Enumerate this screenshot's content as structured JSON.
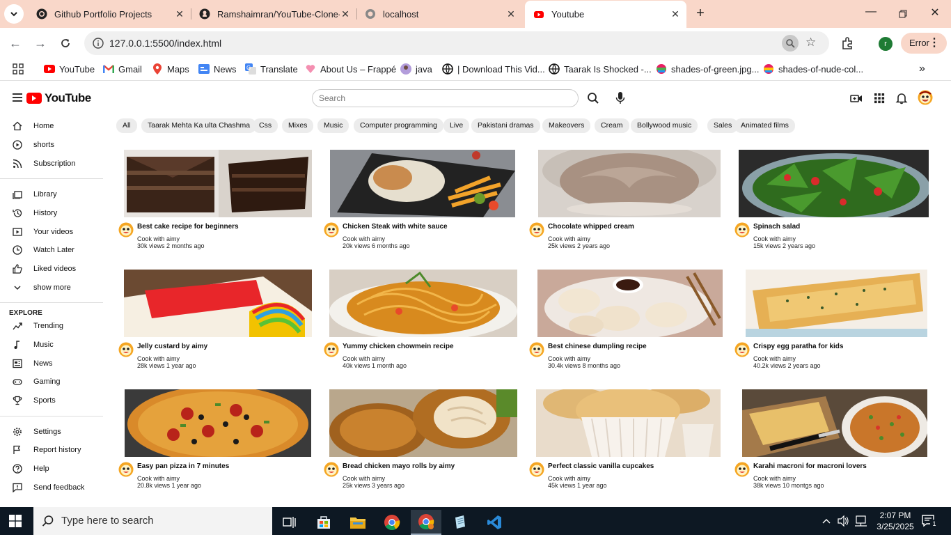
{
  "browser": {
    "tabs": [
      {
        "title": "Github Portfolio Projects",
        "icon": "github-circle-icon"
      },
      {
        "title": "Ramshaimran/YouTube-Clone-i",
        "icon": "github-icon"
      },
      {
        "title": "localhost",
        "icon": "globe-icon"
      },
      {
        "title": "Youtube",
        "icon": "youtube-icon",
        "active": true
      }
    ],
    "url": "127.0.0.1:5500/index.html",
    "profile_initial": "r",
    "error_label": "Error",
    "bookmarks": [
      {
        "label": "YouTube",
        "icon": "youtube-icon"
      },
      {
        "label": "Gmail",
        "icon": "gmail-icon"
      },
      {
        "label": "Maps",
        "icon": "maps-icon"
      },
      {
        "label": "News",
        "icon": "news-icon"
      },
      {
        "label": "Translate",
        "icon": "translate-icon"
      },
      {
        "label": "About Us – Frappé",
        "icon": "heart-icon"
      },
      {
        "label": "java",
        "icon": "user-icon"
      },
      {
        "label": "| Download This Vid...",
        "icon": "globe-icon"
      },
      {
        "label": "Taarak Is Shocked -...",
        "icon": "globe-icon"
      },
      {
        "label": "shades-of-green.jpg...",
        "icon": "image-icon"
      },
      {
        "label": "shades-of-nude-col...",
        "icon": "image-icon"
      }
    ]
  },
  "yt": {
    "logo": "YouTube",
    "search_placeholder": "Search",
    "sidebar": {
      "main": [
        "Home",
        "shorts",
        "Subscription"
      ],
      "library": [
        "Library",
        "History",
        "Your videos",
        "Watch Later",
        "Liked videos",
        "show more"
      ],
      "explore_heading": "EXPLORE",
      "explore": [
        "Trending",
        "Music",
        "News",
        "Gaming",
        "Sports"
      ],
      "footer": [
        "Settings",
        "Report history",
        "Help",
        "Send feedback"
      ]
    },
    "chips": [
      "All",
      "Taarak Mehta Ka ulta Chashma",
      "Css",
      "Mixes",
      "Music",
      "Computer programming",
      "Live",
      "Pakistani dramas",
      "Makeovers",
      "Cream",
      "Bollywood music",
      "Sales",
      "Animated films"
    ],
    "videos": [
      {
        "title": "Best cake recipe for beginners",
        "channel": "Cook with aimy",
        "meta": "30k views 2 months ago"
      },
      {
        "title": "Chicken Steak with white sauce",
        "channel": "Cook with aimy",
        "meta": "20k views 6 months ago"
      },
      {
        "title": "Chocolate whipped cream",
        "channel": "Cook with aimy",
        "meta": "25k views 2 years ago"
      },
      {
        "title": "Spinach salad",
        "channel": "Cook with aimy",
        "meta": "15k views 2 years ago"
      },
      {
        "title": "Jelly custard by aimy",
        "channel": "Cook with aimy",
        "meta": "28k views 1 year ago"
      },
      {
        "title": "Yummy chicken chowmein recipe",
        "channel": "Cook with aimy",
        "meta": "40k views 1 month ago"
      },
      {
        "title": "Best chinese dumpling recipe",
        "channel": "Cook with aimy",
        "meta": "30.4k views 8 months ago"
      },
      {
        "title": "Crispy egg paratha for kids",
        "channel": "Cook with aimy",
        "meta": "40.2k views 2 years ago"
      },
      {
        "title": "Easy pan pizza in 7 minutes",
        "channel": "Cook with aimy",
        "meta": "20.8k views 1 year ago"
      },
      {
        "title": "Bread chicken mayo rolls by aimy",
        "channel": "Cook with aimy",
        "meta": "25k views 3 years ago"
      },
      {
        "title": "Perfect classic vanilla cupcakes",
        "channel": "Cook with aimy",
        "meta": "45k views 1 year ago"
      },
      {
        "title": "Karahi macroni for macroni lovers",
        "channel": "Cook with aimy",
        "meta": "38k views 10 montgs ago"
      }
    ]
  },
  "taskbar": {
    "search_placeholder": "Type here to search",
    "time": "2:07 PM",
    "date": "3/25/2025",
    "notification_count": "1"
  }
}
